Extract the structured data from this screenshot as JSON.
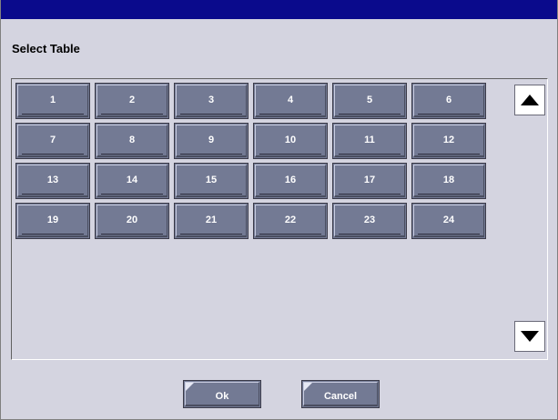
{
  "dialog": {
    "title": "Select Table"
  },
  "tables": [
    "1",
    "2",
    "3",
    "4",
    "5",
    "6",
    "7",
    "8",
    "9",
    "10",
    "11",
    "12",
    "13",
    "14",
    "15",
    "16",
    "17",
    "18",
    "19",
    "20",
    "21",
    "22",
    "23",
    "24"
  ],
  "scroll": {
    "up_icon": "triangle-up-icon",
    "down_icon": "triangle-down-icon"
  },
  "buttons": {
    "ok": "Ok",
    "cancel": "Cancel"
  },
  "colors": {
    "titlebar": "#0a0a8c",
    "dialog_bg": "#d4d4e0",
    "button_face": "#737a94"
  }
}
